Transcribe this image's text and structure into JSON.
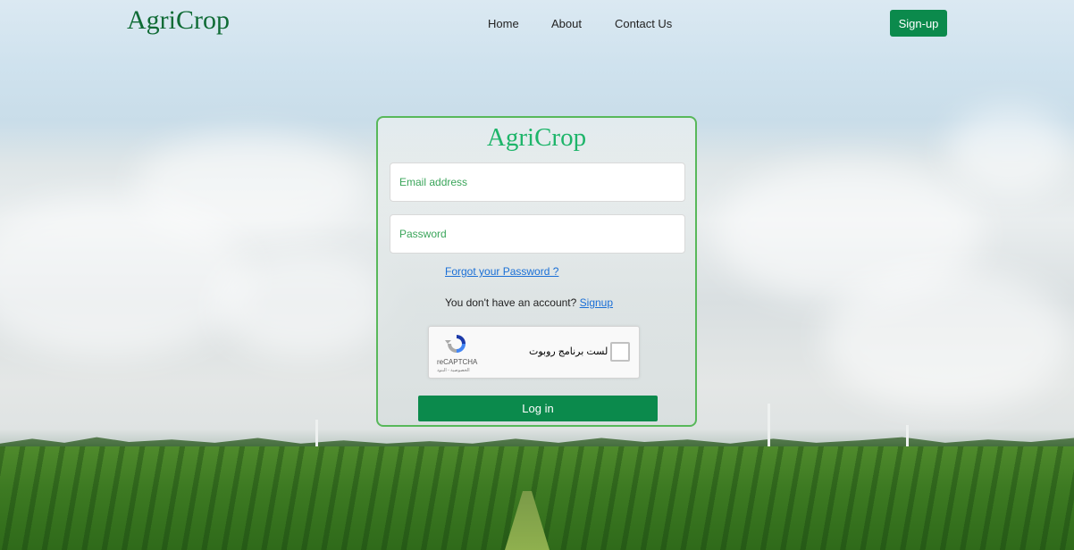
{
  "navbar": {
    "brand": "AgriCrop",
    "links": [
      "Home",
      "About",
      "Contact Us"
    ],
    "signup_label": "Sign-up"
  },
  "login_card": {
    "title": "AgriCrop",
    "email_placeholder": "Email address",
    "password_placeholder": "Password",
    "forgot_password": "Forgot your Password ?",
    "no_account_text": "You don't have an account?",
    "signup_link": "Signup",
    "recaptcha": {
      "label": "أنا لست برنامج روبوت",
      "brand": "reCAPTCHA",
      "terms": "الخصوصية - البنود"
    },
    "login_label": "Log in"
  },
  "colors": {
    "brand_green": "#0f6b35",
    "button_green": "#0b8a4c",
    "card_border": "#58b85a",
    "link_blue": "#1a6fd6"
  }
}
